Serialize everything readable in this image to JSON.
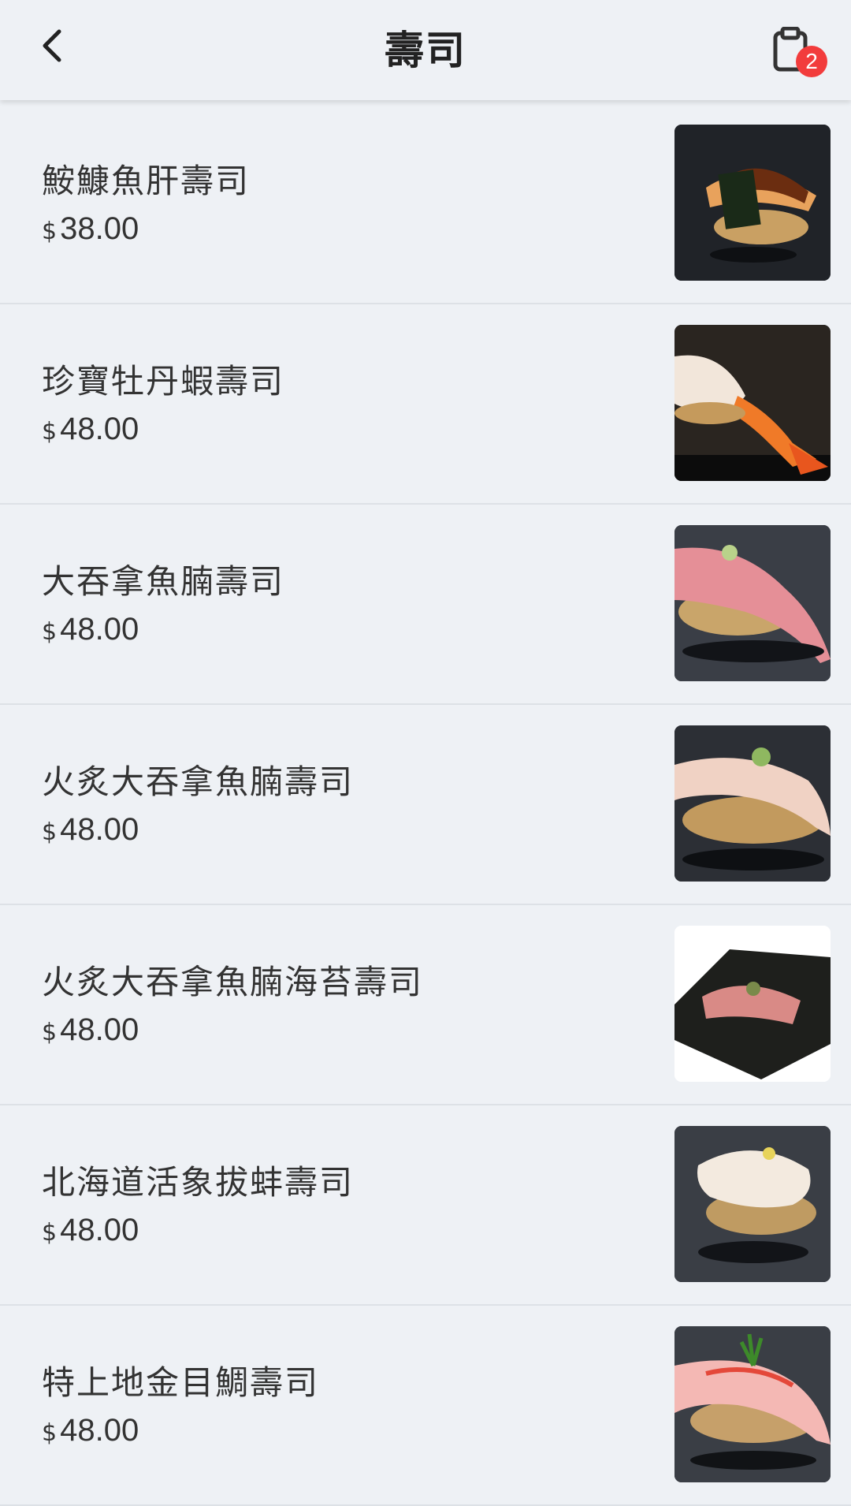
{
  "header": {
    "title": "壽司",
    "cart_count": "2"
  },
  "items": [
    {
      "name": "鮟鱇魚肝壽司",
      "currency": "$",
      "price": "38.00",
      "image": "ankimo-sushi"
    },
    {
      "name": "珍寶牡丹蝦壽司",
      "currency": "$",
      "price": "48.00",
      "image": "botan-shrimp-sushi"
    },
    {
      "name": "大吞拿魚腩壽司",
      "currency": "$",
      "price": "48.00",
      "image": "otoro-sushi"
    },
    {
      "name": "火炙大吞拿魚腩壽司",
      "currency": "$",
      "price": "48.00",
      "image": "seared-otoro-sushi"
    },
    {
      "name": "火炙大吞拿魚腩海苔壽司",
      "currency": "$",
      "price": "48.00",
      "image": "seared-otoro-nori-sushi"
    },
    {
      "name": "北海道活象拔蚌壽司",
      "currency": "$",
      "price": "48.00",
      "image": "geoduck-sushi"
    },
    {
      "name": "特上地金目鯛壽司",
      "currency": "$",
      "price": "48.00",
      "image": "kinmedai-sushi"
    }
  ]
}
